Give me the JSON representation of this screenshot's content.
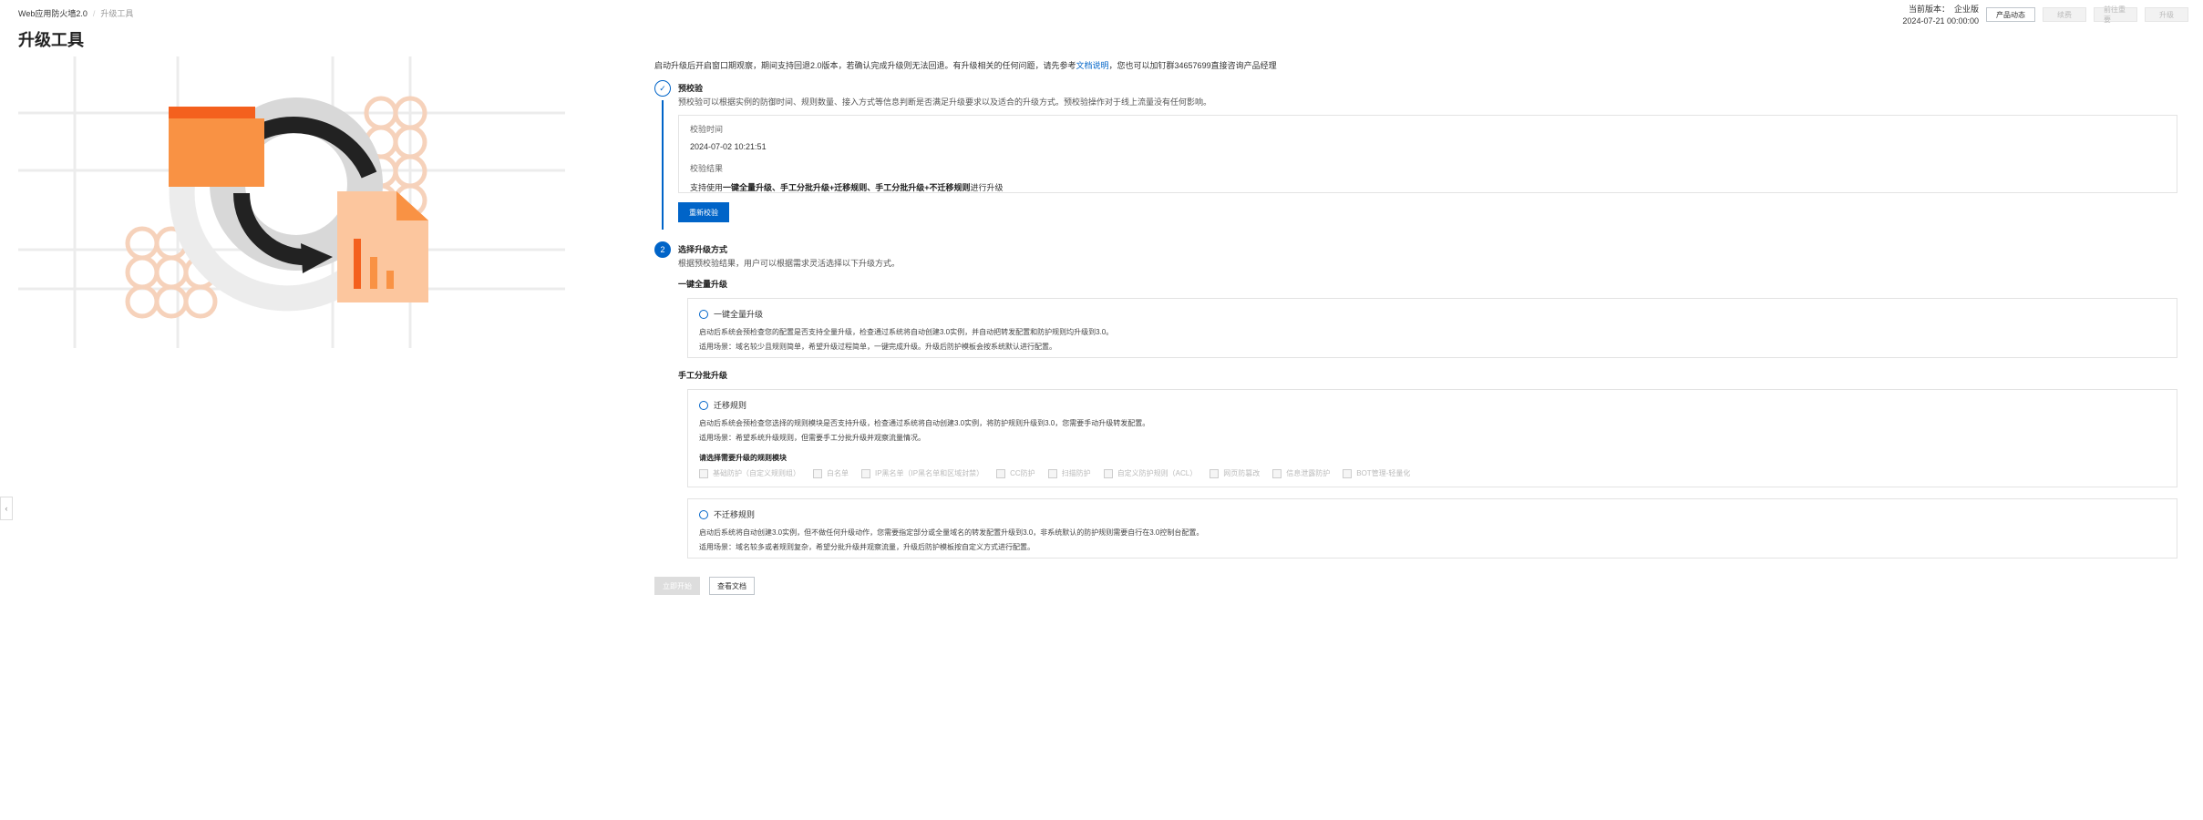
{
  "breadcrumb": {
    "parent": "Web应用防火墙2.0",
    "current": "升级工具"
  },
  "page_title": "升级工具",
  "header": {
    "version_label": "当前版本：",
    "version_value": "企业版",
    "expire_date": "2024-07-21 00:00:00",
    "buttons": [
      "产品动态",
      "续费",
      "前往重要",
      "升级"
    ]
  },
  "intro": {
    "text_before": "启动升级后开启窗口期观察，期间支持回退2.0版本，若确认完成升级则无法回退。有升级相关的任何问题，请先参考",
    "link": "文档说明",
    "text_after": "，您也可以加钉群34657699直接咨询产品经理"
  },
  "step1": {
    "icon": "check-icon",
    "title": "预校验",
    "desc": "预校验可以根据实例的防御时间、规则数量、接入方式等信息判断是否满足升级要求以及适合的升级方式。预校验操作对于线上流量没有任何影响。",
    "time_label": "校验时间",
    "time_value": "2024-07-02 10:21:51",
    "result_label": "校验结果",
    "result_prefix": "支持使用",
    "result_bold": "一键全量升级、手工分批升级+迁移规则、手工分批升级+不迁移规则",
    "result_suffix": "进行升级",
    "recheck_button": "重新校验"
  },
  "step2": {
    "number": "2",
    "title": "选择升级方式",
    "desc": "根据预校验结果，用户可以根据需求灵活选择以下升级方式。",
    "section_a": "一键全量升级",
    "option_a": {
      "label": "一键全量升级",
      "line1": "启动后系统会预检查您的配置是否支持全量升级，检查通过系统将自动创建3.0实例，并自动把转发配置和防护规则均升级到3.0。",
      "line2": "适用场景：域名较少且规则简单，希望升级过程简单，一键完成升级。升级后防护模板会按系统默认进行配置。"
    },
    "section_b": "手工分批升级",
    "option_b": {
      "label": "迁移规则",
      "line1": "启动后系统会预检查您选择的规则模块是否支持升级，检查通过系统将自动创建3.0实例，将防护规则升级到3.0，您需要手动升级转发配置。",
      "line2": "适用场景：希望系统升级规则，但需要手工分批升级并观察流量情况。",
      "sub_label": "请选择需要升级的规则模块",
      "modules": [
        "基础防护（自定义规则组）",
        "白名单",
        "IP黑名单（IP黑名单和区域封禁）",
        "CC防护",
        "扫描防护",
        "自定义防护规则（ACL）",
        "网页防篡改",
        "信息泄露防护",
        "BOT管理-轻量化"
      ]
    },
    "option_c": {
      "label": "不迁移规则",
      "line1": "启动后系统将自动创建3.0实例，但不做任何升级动作，您需要指定部分或全量域名的转发配置升级到3.0，非系统默认的防护规则需要自行在3.0控制台配置。",
      "line2": "适用场景：域名较多或者规则复杂，希望分批升级并观察流量，升级后防护模板按自定义方式进行配置。"
    }
  },
  "footer": {
    "start_button": "立即开始",
    "docs_button": "查看文档"
  },
  "colors": {
    "accent": "#0064c8",
    "orange": "#f78a3a",
    "peach": "#fbc79a"
  }
}
